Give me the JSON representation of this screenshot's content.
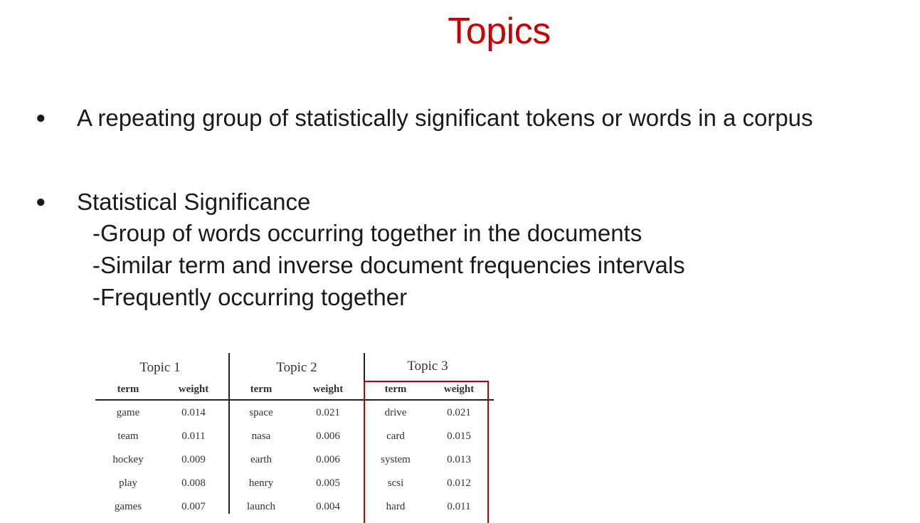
{
  "slide": {
    "title": "Topics",
    "bullets": [
      {
        "text": "A repeating group of statistically significant tokens or words in a corpus"
      },
      {
        "text": "Statistical Significance",
        "subpoints": [
          "-Group of words occurring together in the documents",
          "-Similar term and inverse document frequencies intervals",
          "-Frequently occurring together"
        ]
      }
    ],
    "bullet_symbol": "●"
  },
  "topics_table": {
    "columns": [
      "term",
      "weight"
    ],
    "topics": [
      {
        "name": "Topic 1",
        "rows": [
          [
            "game",
            "0.014"
          ],
          [
            "team",
            "0.011"
          ],
          [
            "hockey",
            "0.009"
          ],
          [
            "play",
            "0.008"
          ],
          [
            "games",
            "0.007"
          ]
        ]
      },
      {
        "name": "Topic 2",
        "rows": [
          [
            "space",
            "0.021"
          ],
          [
            "nasa",
            "0.006"
          ],
          [
            "earth",
            "0.006"
          ],
          [
            "henry",
            "0.005"
          ],
          [
            "launch",
            "0.004"
          ]
        ]
      },
      {
        "name": "Topic 3",
        "rows": [
          [
            "drive",
            "0.021"
          ],
          [
            "card",
            "0.015"
          ],
          [
            "system",
            "0.013"
          ],
          [
            "scsi",
            "0.012"
          ],
          [
            "hard",
            "0.011"
          ]
        ]
      }
    ],
    "highlighted_topic": "Topic 3",
    "highlight_color": "#c00000"
  },
  "colors": {
    "title": "#cc0000",
    "text": "#1a1a1a"
  }
}
